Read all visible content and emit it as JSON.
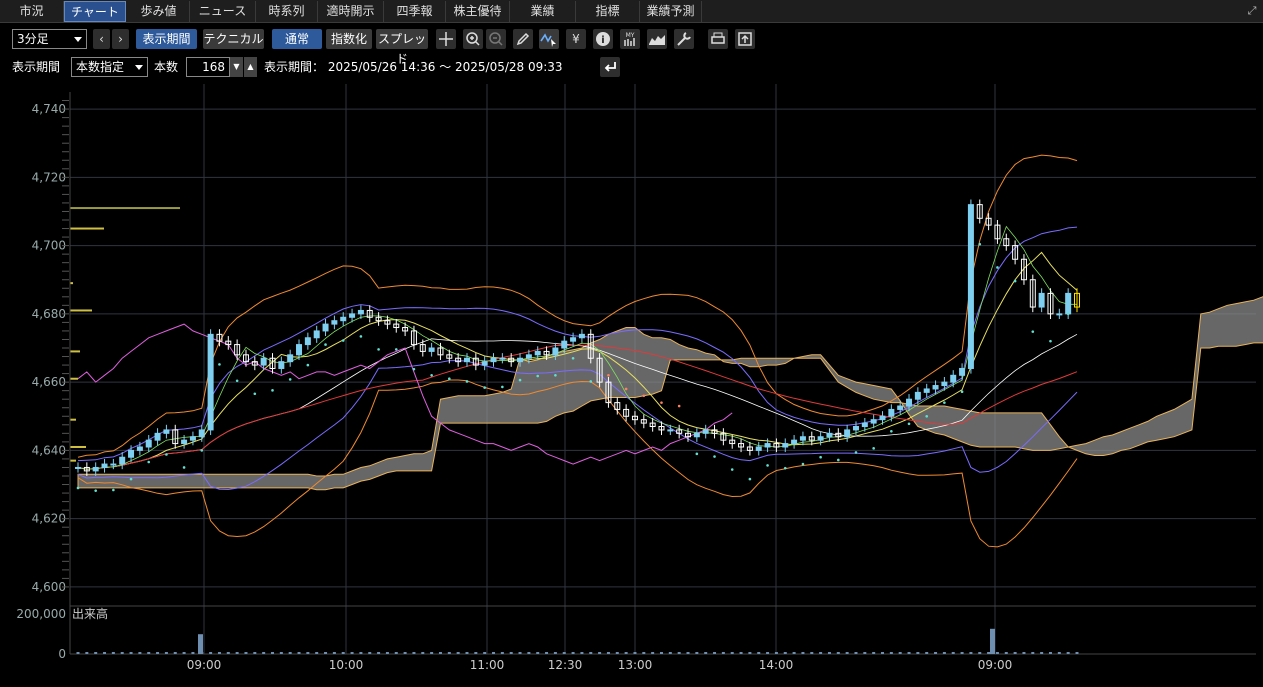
{
  "tabs": [
    {
      "label": "市況",
      "active": false
    },
    {
      "label": "チャート",
      "active": true
    },
    {
      "label": "歩み値",
      "active": false
    },
    {
      "label": "ニュース",
      "active": false
    },
    {
      "label": "時系列",
      "active": false
    },
    {
      "label": "適時開示",
      "active": false
    },
    {
      "label": "四季報",
      "active": false
    },
    {
      "label": "株主優待",
      "active": false
    },
    {
      "label": "業績",
      "active": false
    },
    {
      "label": "指標",
      "active": false
    },
    {
      "label": "業績予測",
      "active": false
    }
  ],
  "toolbar": {
    "timeframe": "3分足",
    "period_button": "表示期間",
    "technical_button": "テクニカル",
    "normal_button": "通常",
    "index_button": "指数化",
    "spread_button": "スプレッド",
    "icons": [
      "crosshair-icon",
      "zoom-in-icon",
      "zoom-out-icon",
      "pencil-icon",
      "chart-cursor-icon",
      "yen-icon",
      "info-icon",
      "my-indicator-icon",
      "area-chart-icon",
      "wrench-icon",
      "print-icon",
      "export-icon"
    ],
    "yen_glyph": "¥",
    "info_glyph": "i",
    "my_glyph": "MY"
  },
  "period_row": {
    "label": "表示期間",
    "mode": "本数指定",
    "count_label": "本数",
    "count": "168",
    "range_text": "表示期間： 2025/05/26 14:36 ～ 2025/05/28 09:33"
  },
  "chart_data": {
    "type": "candlestick",
    "y_ticks": [
      "4,740",
      "4,720",
      "4,700",
      "4,680",
      "4,660",
      "4,640",
      "4,620",
      "4,600"
    ],
    "ylim": [
      4595,
      4745
    ],
    "x_ticks": [
      "09:00",
      "10:00",
      "11:00",
      "12:30",
      "13:00",
      "14:00",
      "09:00"
    ],
    "volume_label": "出来高",
    "volume_tick": "200,000",
    "volume_zero": "0",
    "closes": [
      4635,
      4634,
      4635,
      4636,
      4636,
      4638,
      4640,
      4641,
      4643,
      4645,
      4646,
      4642,
      4643,
      4644,
      4646,
      4674,
      4672,
      4671,
      4668,
      4666,
      4665,
      4667,
      4664,
      4666,
      4668,
      4671,
      4673,
      4675,
      4677,
      4678,
      4679,
      4680,
      4681,
      4679,
      4678,
      4677,
      4676,
      4675,
      4671,
      4669,
      4670,
      4668,
      4667,
      4666,
      4667,
      4665,
      4666,
      4667,
      4667,
      4666,
      4667,
      4668,
      4669,
      4668,
      4670,
      4672,
      4673,
      4674,
      4667,
      4660,
      4654,
      4652,
      4650,
      4649,
      4648,
      4647,
      4646,
      4646,
      4645,
      4644,
      4645,
      4646,
      4645,
      4643,
      4642,
      4641,
      4640,
      4641,
      4642,
      4641,
      4642,
      4643,
      4644,
      4643,
      4644,
      4645,
      4644,
      4646,
      4647,
      4648,
      4649,
      4650,
      4652,
      4653,
      4655,
      4657,
      4658,
      4659,
      4660,
      4662,
      4664,
      4712,
      4708,
      4706,
      4702,
      4700,
      4696,
      4690,
      4682,
      4686,
      4680,
      4680,
      4686,
      4682
    ],
    "volume_spikes": [
      {
        "x": "09:00",
        "value": 110000
      },
      {
        "x": "09:00",
        "value": 140000
      }
    ]
  },
  "colors": {
    "grid": "#2f3440",
    "up": "#7fd0f0",
    "down": "#ffffff",
    "cloud_fill": "#8a8a8a",
    "cloud_edge": "#e8b35a",
    "last_bar": "#ffe000"
  }
}
